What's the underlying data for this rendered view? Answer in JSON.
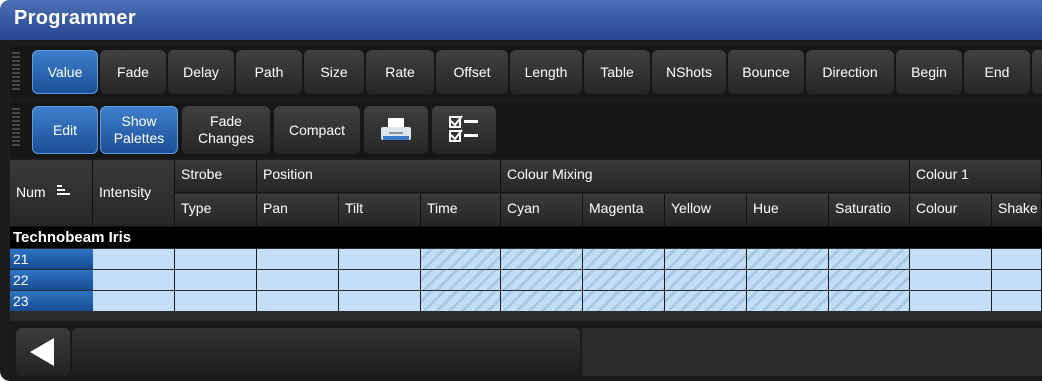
{
  "window": {
    "title": "Programmer"
  },
  "toolbar1": {
    "buttons": [
      "Value",
      "Fade",
      "Delay",
      "Path",
      "Size",
      "Rate",
      "Offset",
      "Length",
      "Table",
      "NShots",
      "Bounce",
      "Direction",
      "Begin",
      "End"
    ],
    "active_index": 0
  },
  "toolbar2": {
    "edit": "Edit",
    "show_palettes_line1": "Show",
    "show_palettes_line2": "Palettes",
    "fade_changes_line1": "Fade",
    "fade_changes_line2": "Changes",
    "compact": "Compact",
    "icons": [
      "printer-icon",
      "checklist-icon"
    ]
  },
  "grid": {
    "headers_top": {
      "num": "Num",
      "intensity": "Intensity",
      "strobe": "Strobe",
      "position": "Position",
      "colour_mixing": "Colour Mixing",
      "colour1": "Colour 1"
    },
    "headers_bottom": [
      "Type",
      "Pan",
      "Tilt",
      "Time",
      "Cyan",
      "Magenta",
      "Yellow",
      "Hue",
      "Saturatio",
      "Colour",
      "Shake"
    ],
    "group": "Technobeam Iris",
    "rows": [
      "21",
      "22",
      "23"
    ]
  },
  "colors": {
    "title_bar": "#3a5fa8",
    "active_button": "#2b68b4",
    "cell": "#c2def8",
    "row_number": "#1f5aa6"
  }
}
